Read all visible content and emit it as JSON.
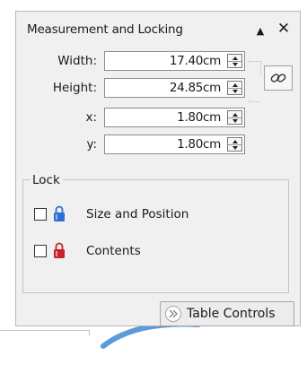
{
  "palette": {
    "title": "Measurement and Locking",
    "collapse_icon": "triangle-up-icon",
    "close_icon": "close-icon",
    "close_glyph": "✕",
    "collapse_glyph": "▲"
  },
  "fields": [
    {
      "label": "Width:",
      "value": "17.40cm"
    },
    {
      "label": "Height:",
      "value": "24.85cm"
    },
    {
      "label": "x:",
      "value": "1.80cm"
    },
    {
      "label": "y:",
      "value": "1.80cm"
    }
  ],
  "link_toggle": {
    "icon": "chain-link-icon"
  },
  "lock": {
    "title": "Lock",
    "items": [
      {
        "label": "Size and Position",
        "checked": false,
        "icon": "padlock-icon",
        "icon_color": "#2f6fd3"
      },
      {
        "label": "Contents",
        "checked": false,
        "icon": "padlock-icon",
        "icon_color": "#c8232d"
      }
    ]
  },
  "table_controls": {
    "label": "Table Controls",
    "icon": "chevron-right-double-icon"
  },
  "colors": {
    "panel_bg": "#f0f0f0",
    "accent_blue": "#2f6fd3",
    "accent_red": "#c8232d",
    "arc_blue": "#5a9bdc"
  }
}
